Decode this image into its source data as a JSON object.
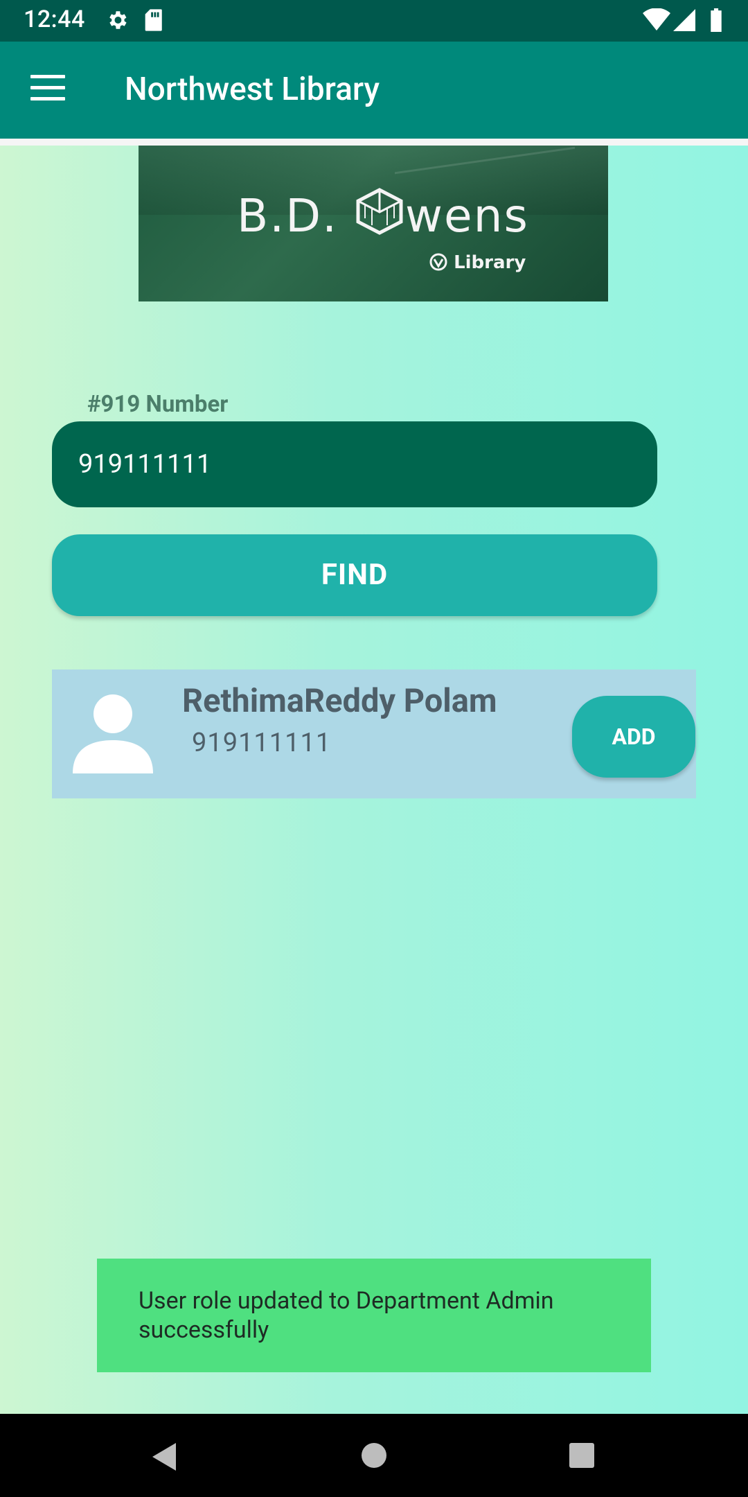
{
  "status_bar": {
    "time": "12:44",
    "icons": [
      "settings-icon",
      "sd-card-icon",
      "wifi-icon",
      "signal-icon",
      "battery-icon"
    ]
  },
  "app_bar": {
    "title": "Northwest Library",
    "menu_icon": "hamburger-menu-icon"
  },
  "banner": {
    "brand_left": "B.D.",
    "brand_right": "wens",
    "subtitle": "Library"
  },
  "search": {
    "label": "#919 Number",
    "value": "919111111",
    "find_label": "FIND"
  },
  "result": {
    "name": "RethimaReddy Polam",
    "number": "919111111",
    "add_label": "ADD"
  },
  "toast": {
    "message": "User role updated to Department Admin successfully"
  },
  "nav_bar": {
    "back": "back-icon",
    "home": "home-icon",
    "recents": "recents-icon"
  },
  "colors": {
    "status_bar": "#00594d",
    "app_bar": "#00897b",
    "input_bg": "#00664e",
    "button": "#20b2aa",
    "result_bg": "#add8e6",
    "toast_bg": "#4fe080"
  }
}
